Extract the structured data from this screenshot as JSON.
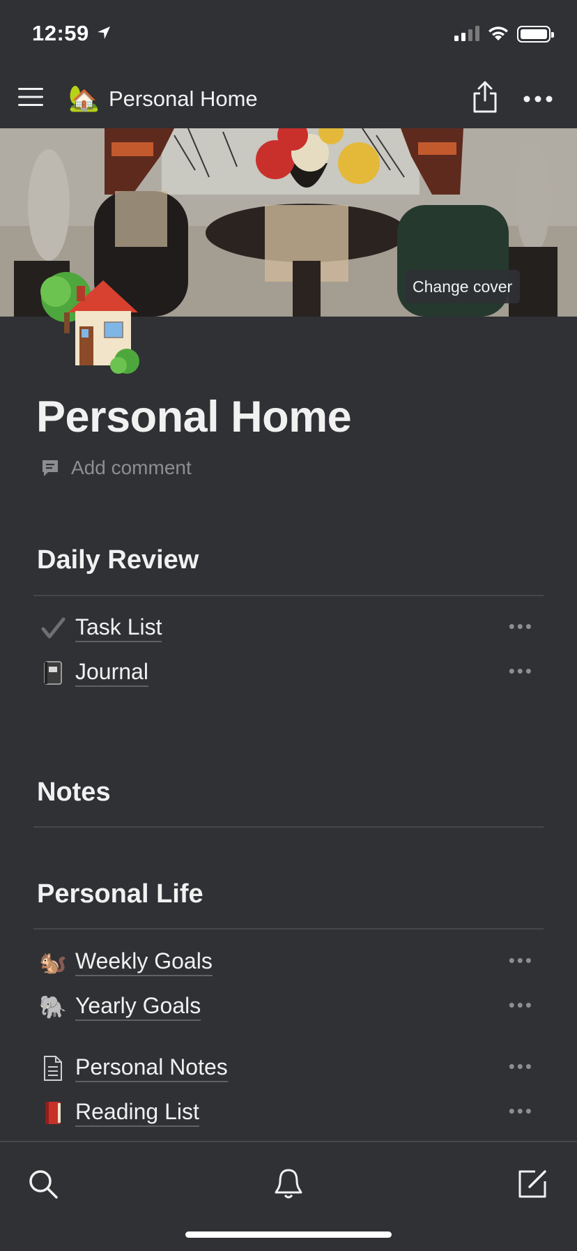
{
  "status_bar": {
    "time": "12:59"
  },
  "nav": {
    "title": "Personal Home",
    "icon": "house-with-garden-emoji"
  },
  "cover": {
    "change_cover_label": "Change cover"
  },
  "page": {
    "title": "Personal Home",
    "add_comment": "Add comment"
  },
  "sections": {
    "daily_review": {
      "heading": "Daily Review",
      "items": [
        {
          "label": "Task List",
          "icon": "check-mark-icon"
        },
        {
          "label": "Journal",
          "icon": "notebook-icon"
        }
      ]
    },
    "notes": {
      "heading": "Notes"
    },
    "personal_life": {
      "heading": "Personal Life",
      "items": [
        {
          "label": "Weekly Goals",
          "icon": "chipmunk-icon"
        },
        {
          "label": "Yearly Goals",
          "icon": "elephant-icon"
        },
        {
          "label": "Personal Notes",
          "icon": "document-icon"
        },
        {
          "label": "Reading List",
          "icon": "red-book-icon"
        }
      ]
    }
  },
  "row_more_glyph": "•••",
  "bottom_bar": {
    "icons": [
      "search-icon",
      "bell-icon",
      "compose-icon"
    ]
  }
}
